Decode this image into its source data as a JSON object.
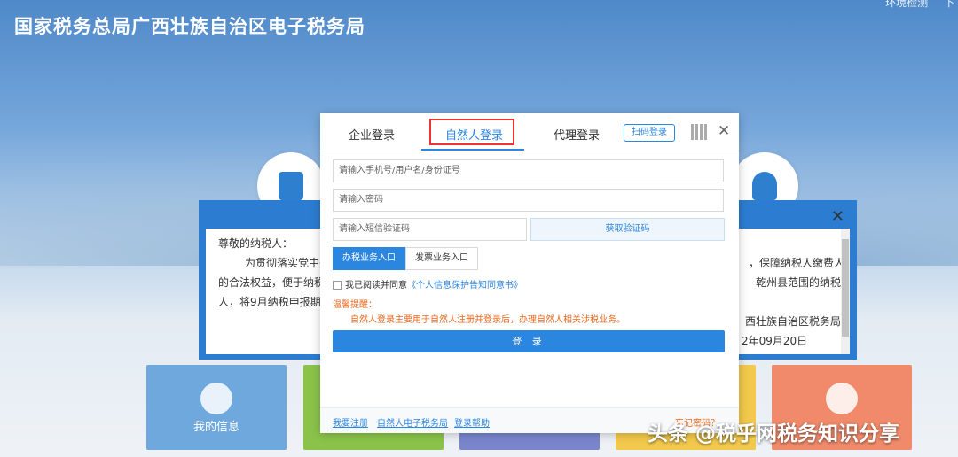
{
  "header": {
    "site_title": "国家税务总局广西壮族自治区电子税务局",
    "env_check": "环境检测",
    "download": "下"
  },
  "notice": {
    "greeting": "尊敬的纳税人：",
    "line1": "为贯彻落实党中央",
    "line1_right": "，保障纳税人缴费人",
    "line2": "的合法权益，便于纳税人",
    "line2_right": "乾州县范围的纳税",
    "line3": "人，将9月纳税申报期限",
    "signature": "西壮族自治区税务局",
    "date": "2年09月20日",
    "close": "✕"
  },
  "tiles": [
    {
      "label": "我的信息",
      "color": "#6fa8dc"
    },
    {
      "label": "",
      "color": "#8bc34a"
    },
    {
      "label": "",
      "color": "#7986cb"
    },
    {
      "label": "",
      "color": "#f2c94c"
    },
    {
      "label": "",
      "color": "#f08a6a"
    }
  ],
  "login": {
    "tabs": [
      "企业登录",
      "自然人登录",
      "代理登录"
    ],
    "active_tab": 1,
    "scan_login": "扫码登录",
    "close": "✕",
    "account_placeholder": "请输入手机号/用户名/身份证号",
    "password_placeholder": "请输入密码",
    "sms_placeholder": "请输入短信验证码",
    "get_code": "获取验证码",
    "entry_tax": "办税业务入口",
    "entry_invoice": "发票业务入口",
    "agree_prefix": "我已阅读并同意",
    "agree_link": "《个人信息保护告知同意书》",
    "tip_title": "温馨提醒：",
    "tip_text": "自然人登录主要用于自然人注册并登录后，办理自然人相关涉税业务。",
    "login_button": "登 录",
    "footer_links": [
      "我要注册",
      "自然人电子税务局",
      "登录帮助"
    ],
    "forgot": "忘记密码？"
  },
  "watermark": "头条 @税乎网税务知识分享",
  "colors": {
    "accent": "#2b86e0",
    "warning": "#e8681e",
    "highlight": "#e33333"
  }
}
